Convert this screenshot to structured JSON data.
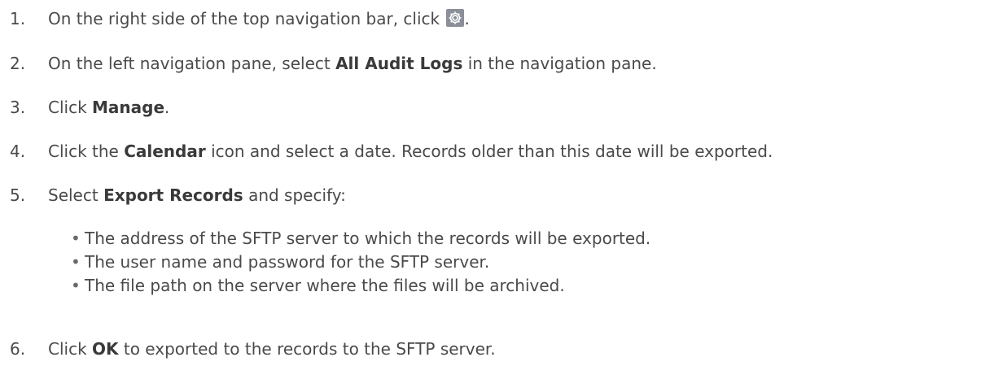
{
  "steps": [
    {
      "number": "1.",
      "before": "On the right side of the top navigation bar, click ",
      "icon": "gear-icon",
      "after": "."
    },
    {
      "number": "2.",
      "before": "On the left navigation pane, select ",
      "bold": "All Audit Logs",
      "after": " in the navigation pane."
    },
    {
      "number": "3.",
      "before": "Click ",
      "bold": "Manage",
      "after": "."
    },
    {
      "number": "4.",
      "before": "Click the ",
      "bold": "Calendar",
      "after": " icon and select a date. Records older than this date will be exported."
    },
    {
      "number": "5.",
      "before": "Select ",
      "bold": "Export Records",
      "after": " and specify:"
    },
    {
      "number": "6.",
      "before": "Click ",
      "bold": "OK",
      "after": " to exported to the records to the SFTP server."
    }
  ],
  "sub_items": [
    "The address of the SFTP server to which the records will be exported.",
    "The user name and password for the SFTP server.",
    "The file path on the server where the files will be archived."
  ],
  "bullet_glyph": "•",
  "colors": {
    "text": "#4a4a4a",
    "icon_bg": "#8a8f99"
  }
}
